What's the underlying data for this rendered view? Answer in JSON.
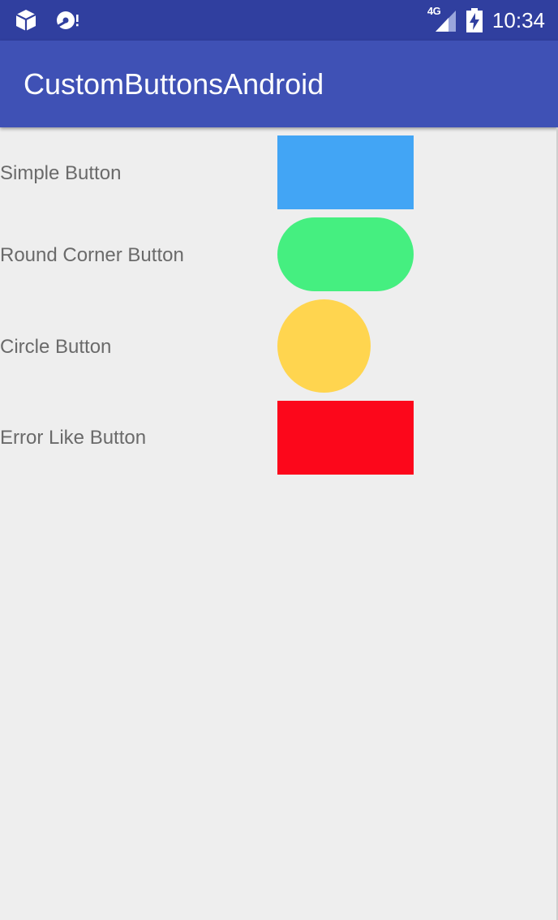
{
  "status_bar": {
    "network_type": "4G",
    "time": "10:34",
    "icons": [
      "app-box-icon",
      "media-disc-icon",
      "cell-signal-icon",
      "battery-charging-icon"
    ]
  },
  "app_bar": {
    "title": "CustomButtonsAndroid"
  },
  "rows": [
    {
      "label": "Simple Button",
      "button_color": "#42a5f5"
    },
    {
      "label": " Round Corner Button",
      "button_color": "#45ef80"
    },
    {
      "label": "Circle Button",
      "button_color": "#ffd54f"
    },
    {
      "label": "Error Like Button",
      "button_color": "#fc071b"
    }
  ],
  "colors": {
    "status_bar": "#303f9f",
    "app_bar": "#3f51b5",
    "background": "#eeeeee",
    "label_text": "#6a6a6a"
  }
}
